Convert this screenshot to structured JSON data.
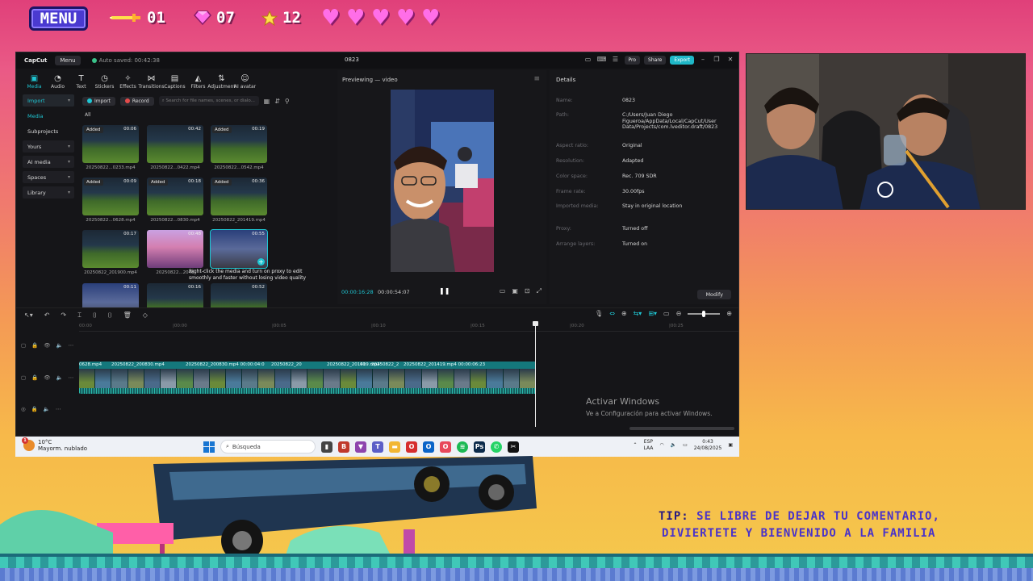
{
  "overlay": {
    "menu_label": "MENU",
    "stats": [
      {
        "icon": "sword-icon",
        "value": "01"
      },
      {
        "icon": "gem-icon",
        "value": "07"
      },
      {
        "icon": "star-icon",
        "value": "12"
      }
    ],
    "hearts": 5,
    "tip_label": "TIP:",
    "tip_line1": "SE LIBRE DE DEJAR TU COMENTARIO,",
    "tip_line2": "DIVIERTETE Y BIENVENIDO A LA FAMILIA"
  },
  "app": {
    "brand": "CapCut",
    "menu": "Menu",
    "autosave": "Auto saved: 00:42:38",
    "project_title": "0823",
    "pro": "Pro",
    "share": "Share",
    "export": "Export",
    "tools": [
      {
        "icon": "media-icon",
        "label": "Media"
      },
      {
        "icon": "audio-icon",
        "label": "Audio"
      },
      {
        "icon": "text-icon",
        "label": "Text"
      },
      {
        "icon": "stickers-icon",
        "label": "Stickers"
      },
      {
        "icon": "effects-icon",
        "label": "Effects"
      },
      {
        "icon": "transitions-icon",
        "label": "Transitions"
      },
      {
        "icon": "captions-icon",
        "label": "Captions"
      },
      {
        "icon": "filters-icon",
        "label": "Filters"
      },
      {
        "icon": "adjustment-icon",
        "label": "Adjustment"
      },
      {
        "icon": "ai-avatar-icon",
        "label": "AI avatar"
      }
    ],
    "sidebar": [
      {
        "label": "Import"
      },
      {
        "label": "Media"
      },
      {
        "label": "Subprojects"
      },
      {
        "label": "Yours"
      },
      {
        "label": "AI media"
      },
      {
        "label": "Spaces"
      },
      {
        "label": "Library"
      }
    ],
    "import_btn": "Import",
    "record_btn": "Record",
    "search_placeholder": "Search for file names, scenes, or dialo...",
    "all_label": "All",
    "media": [
      {
        "badge": "Added",
        "duration": "00:06",
        "name": "20250822...0233.mp4"
      },
      {
        "badge": "",
        "duration": "00:42",
        "name": "20250822...0422.mp4"
      },
      {
        "badge": "Added",
        "duration": "00:19",
        "name": "20250822...0542.mp4"
      },
      {
        "badge": "Added",
        "duration": "00:09",
        "name": "20250822...0628.mp4"
      },
      {
        "badge": "Added",
        "duration": "00:18",
        "name": "20250822...0830.mp4"
      },
      {
        "badge": "Added",
        "duration": "00:36",
        "name": "20250822_201419.mp4"
      },
      {
        "badge": "",
        "duration": "00:17",
        "name": "20250822_201900.mp4"
      },
      {
        "badge": "",
        "duration": "00:48",
        "name": "20250822...2048"
      },
      {
        "badge": "",
        "duration": "00:55",
        "name": ""
      },
      {
        "badge": "",
        "duration": "00:11",
        "name": ""
      },
      {
        "badge": "",
        "duration": "00:16",
        "name": ""
      },
      {
        "badge": "",
        "duration": "00:52",
        "name": ""
      }
    ],
    "tooltip": "Right-click the media and turn on proxy to edit smoothly and faster without losing video quality",
    "preview_title": "Previewing — video",
    "timecode_current": "00:00:16:28",
    "timecode_total": "00:00:54:07",
    "details_title": "Details",
    "details": [
      {
        "k": "Name:",
        "v": "0823"
      },
      {
        "k": "Path:",
        "v": "C:/Users/Juan Diego Figueroa/AppData/Local/CapCut/User Data/Projects/com.lveditor.draft/0823"
      },
      {
        "k": "Aspect ratio:",
        "v": "Original"
      },
      {
        "k": "Resolution:",
        "v": "Adapted"
      },
      {
        "k": "Color space:",
        "v": "Rec. 709 SDR"
      },
      {
        "k": "Frame rate:",
        "v": "30.00fps"
      },
      {
        "k": "Imported media:",
        "v": "Stay in original location"
      },
      {
        "k": "Proxy:",
        "v": "Turned off"
      },
      {
        "k": "Arrange layers:",
        "v": "Turned on"
      }
    ],
    "modify": "Modify",
    "ruler": [
      "00:00",
      "|00:00",
      "|00:05",
      "|00:10",
      "|00:15",
      "|00:20",
      "|00:25"
    ],
    "clip_labels": [
      "0628.mp4",
      "20250822_200830.mp4",
      "20250822_200830.mp4 00:00:04:0",
      "20250822_20",
      "20250822_201419.mp4",
      "00",
      "20250822_2",
      "20250822_201419.mp4 00:00:06:23"
    ],
    "watermark_title": "Activar Windows",
    "watermark_sub": "Ve a Configuración para activar Windows."
  },
  "taskbar": {
    "temp": "10°C",
    "weather": "Mayorm. nublado",
    "weather_badge": "1",
    "search": "Búsqueda",
    "lang1": "ESP",
    "lang2": "LAA",
    "time": "0:43",
    "date": "24/08/2025"
  },
  "colors": {
    "accent": "#1fc6d3",
    "overlay_purple": "#4a33c9"
  }
}
